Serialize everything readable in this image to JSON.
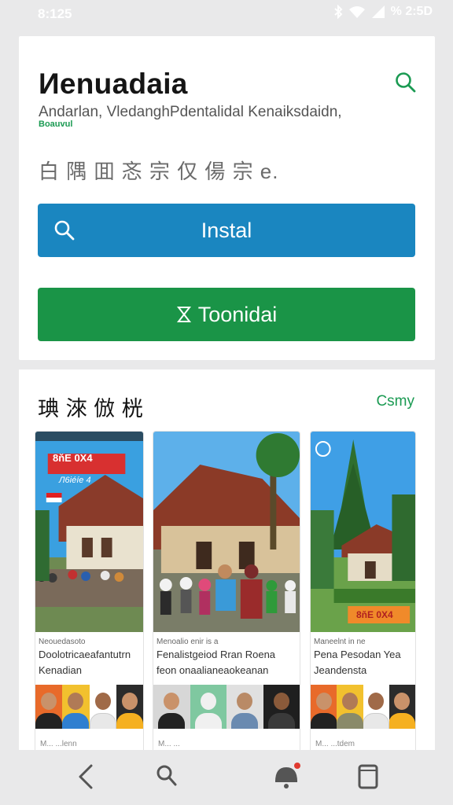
{
  "status": {
    "time": "8:125",
    "battery": "% 2:5D"
  },
  "app": {
    "title": "Иenuadaia",
    "subtitle": "Andarlan, VledanghPdentalidal Kenaiksdaidn,",
    "tag": "Boauvul",
    "description": "白 隅 囬 忞 宗 仅 偒 宗 e."
  },
  "buttons": {
    "install_label": "Instal",
    "second_label": "Toonidai"
  },
  "section": {
    "title": "琠 淶 倣 桄",
    "more_label": "Csmy",
    "tiles": [
      {
        "badge": "8ňE 0X4",
        "subbadge": "Л6iéíe 4",
        "caption_small": "Neouedasoto",
        "caption1": "Doolotricaeafantutrn",
        "caption2": "Kenadian",
        "foot": "M... ...lenn"
      },
      {
        "caption_small": "Menoalio enir is a",
        "caption1": "Fenalistgeiod   Rran  Roena",
        "caption2": "feon  onaalianeaokeanan",
        "foot": "M... ..."
      },
      {
        "badge": "8ňE 0X4",
        "caption_small": "Maneelnt in ne",
        "caption1": "Pena  Pesodan Yea",
        "caption2": "Jeandensta",
        "foot": "M... ...tdem"
      }
    ]
  },
  "colors": {
    "install": "#1a86c0",
    "green": "#1a9447",
    "accent": "#1a9a52"
  },
  "icons": {
    "search": "search-icon",
    "back": "back-icon",
    "notification": "bell-icon",
    "recent": "recent-apps-icon"
  }
}
